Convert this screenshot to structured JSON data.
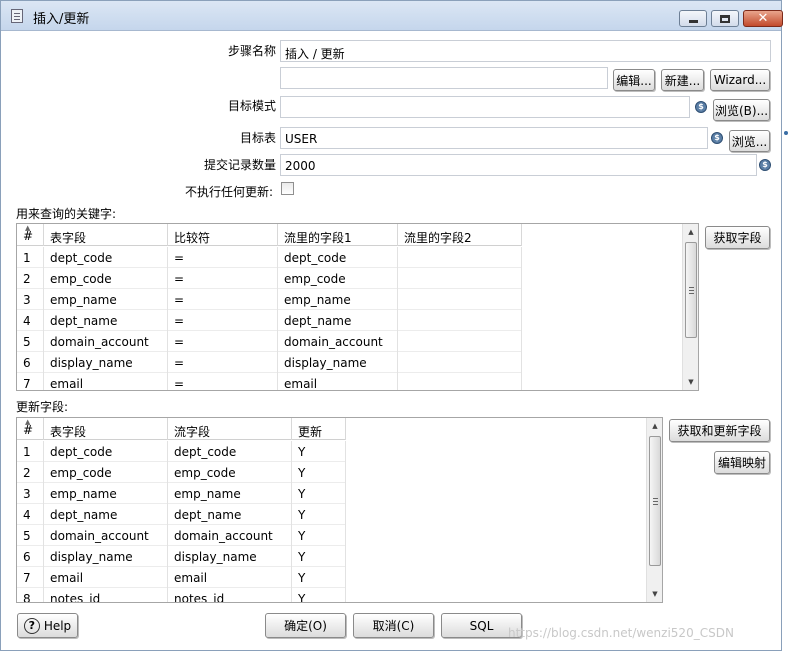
{
  "window": {
    "title": "插入/更新"
  },
  "form": {
    "step_name_label": "步骤名称",
    "step_name_value": "插入 / 更新",
    "connection_value": "",
    "edit_button": "编辑...",
    "new_button": "新建...",
    "wizard_button": "Wizard...",
    "target_schema_label": "目标模式",
    "target_schema_value": "",
    "browse_schema_button": "浏览(B)...",
    "target_table_label": "目标表",
    "target_table_value": "USER",
    "browse_table_button": "浏览...",
    "commit_size_label": "提交记录数量",
    "commit_size_value": "2000",
    "no_update_label": "不执行任何更新:",
    "no_update_checked": false
  },
  "lookup": {
    "section_label": "用来查询的关键字:",
    "get_fields_button": "获取字段",
    "columns": [
      "#",
      "表字段",
      "比较符",
      "流里的字段1",
      "流里的字段2"
    ],
    "rows": [
      [
        "1",
        "dept_code",
        "=",
        "dept_code",
        ""
      ],
      [
        "2",
        "emp_code",
        "=",
        "emp_code",
        ""
      ],
      [
        "3",
        "emp_name",
        "=",
        "emp_name",
        ""
      ],
      [
        "4",
        "dept_name",
        "=",
        "dept_name",
        ""
      ],
      [
        "5",
        "domain_account",
        "=",
        "domain_account",
        ""
      ],
      [
        "6",
        "display_name",
        "=",
        "display_name",
        ""
      ],
      [
        "7",
        "email",
        "=",
        "email",
        ""
      ]
    ]
  },
  "update": {
    "section_label": "更新字段:",
    "get_update_fields_button": "获取和更新字段",
    "edit_mapping_button": "编辑映射",
    "columns": [
      "#",
      "表字段",
      "流字段",
      "更新"
    ],
    "rows": [
      [
        "1",
        "dept_code",
        "dept_code",
        "Y"
      ],
      [
        "2",
        "emp_code",
        "emp_code",
        "Y"
      ],
      [
        "3",
        "emp_name",
        "emp_name",
        "Y"
      ],
      [
        "4",
        "dept_name",
        "dept_name",
        "Y"
      ],
      [
        "5",
        "domain_account",
        "domain_account",
        "Y"
      ],
      [
        "6",
        "display_name",
        "display_name",
        "Y"
      ],
      [
        "7",
        "email",
        "email",
        "Y"
      ],
      [
        "8",
        "notes_id",
        "notes_id",
        "Y"
      ]
    ]
  },
  "footer": {
    "help_button": "Help",
    "ok_button": "确定(O)",
    "cancel_button": "取消(C)",
    "sql_button": "SQL",
    "watermark": "https://blog.csdn.net/wenzi520_CSDN"
  },
  "icons": {
    "variable_icon": "dollar-variable-icon",
    "app_icon": "document-icon",
    "help_icon": "question-circle-icon"
  },
  "colors": {
    "titlebar": "#c5d6ec",
    "close_button": "#c24a2c",
    "variable_icon": "#5b7fa6"
  }
}
